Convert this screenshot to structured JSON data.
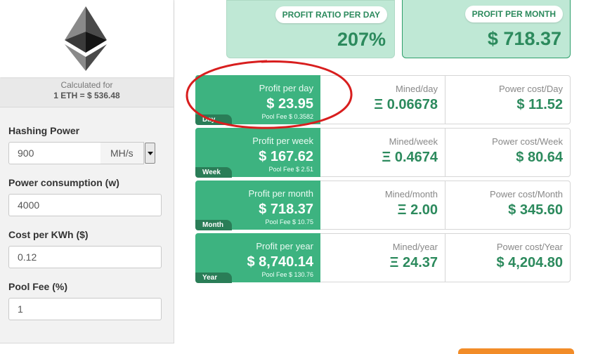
{
  "sidebar": {
    "calculated_for_label": "Calculated for",
    "rate_text": "1 ETH = $ 536.48",
    "hashing_power": {
      "label": "Hashing Power",
      "value": "900",
      "unit": "MH/s"
    },
    "power_consumption": {
      "label": "Power consumption (w)",
      "value": "4000"
    },
    "cost_per_kwh": {
      "label": "Cost per KWh ($)",
      "value": "0.12"
    },
    "pool_fee": {
      "label": "Pool Fee (%)",
      "value": "1"
    }
  },
  "summary": {
    "ratio": {
      "label": "PROFIT RATIO PER DAY",
      "value": "207%"
    },
    "month": {
      "label": "PROFIT PER MONTH",
      "value": "$ 718.37"
    }
  },
  "rows": [
    {
      "period": "Day",
      "profit_label": "Profit per day",
      "profit": "$ 23.95",
      "pool_fee": "Pool Fee $ 0.3582",
      "mined_label": "Mined/day",
      "mined": "Ξ 0.06678",
      "power_label": "Power cost/Day",
      "power": "$ 11.52"
    },
    {
      "period": "Week",
      "profit_label": "Profit per week",
      "profit": "$ 167.62",
      "pool_fee": "Pool Fee $ 2.51",
      "mined_label": "Mined/week",
      "mined": "Ξ 0.4674",
      "power_label": "Power cost/Week",
      "power": "$ 80.64"
    },
    {
      "period": "Month",
      "profit_label": "Profit per month",
      "profit": "$ 718.37",
      "pool_fee": "Pool Fee $ 10.75",
      "mined_label": "Mined/month",
      "mined": "Ξ 2.00",
      "power_label": "Power cost/Month",
      "power": "$ 345.60"
    },
    {
      "period": "Year",
      "profit_label": "Profit per year",
      "profit": "$ 8,740.14",
      "pool_fee": "Pool Fee $ 130.76",
      "mined_label": "Mined/year",
      "mined": "Ξ 24.37",
      "power_label": "Power cost/Year",
      "power": "$ 4,204.80"
    }
  ],
  "colors": {
    "accent_green": "#3db380",
    "dark_green": "#2a7d57",
    "light_green": "#bfe8d5",
    "annotation_red": "#d81e1e"
  },
  "icons": {
    "logo": "ethereum-logo-icon"
  }
}
